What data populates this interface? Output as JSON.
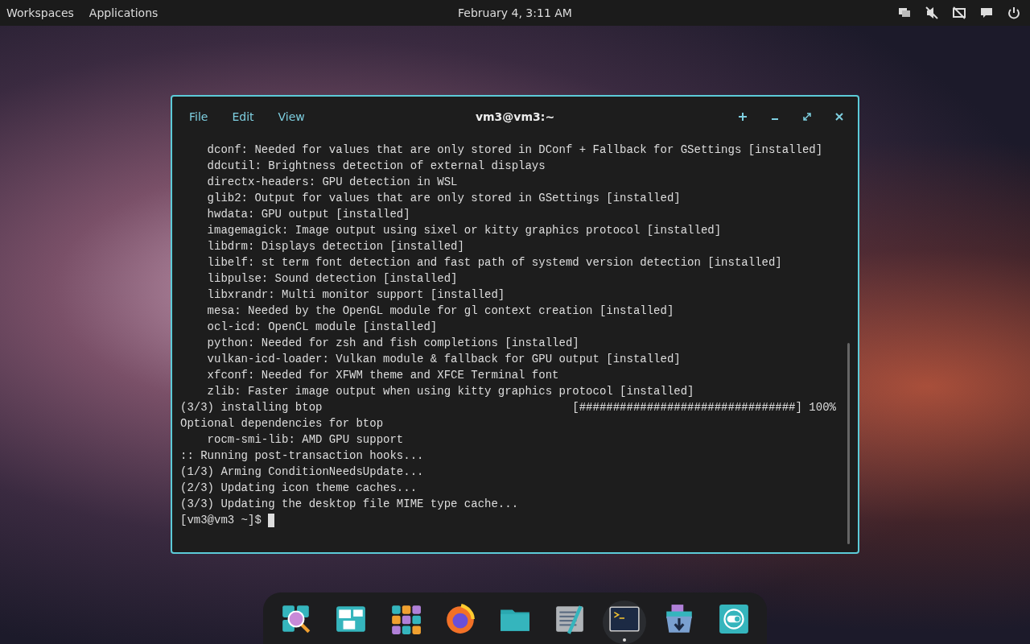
{
  "top_bar": {
    "menus": [
      "Workspaces",
      "Applications"
    ],
    "clock": "February 4, 3:11 AM"
  },
  "terminal": {
    "title": "vm3@vm3:~",
    "menu": [
      "File",
      "Edit",
      "View"
    ],
    "lines": [
      "    dconf: Needed for values that are only stored in DConf + Fallback for GSettings [installed]",
      "    ddcutil: Brightness detection of external displays",
      "    directx-headers: GPU detection in WSL",
      "    glib2: Output for values that are only stored in GSettings [installed]",
      "    hwdata: GPU output [installed]",
      "    imagemagick: Image output using sixel or kitty graphics protocol [installed]",
      "    libdrm: Displays detection [installed]",
      "    libelf: st term font detection and fast path of systemd version detection [installed]",
      "    libpulse: Sound detection [installed]",
      "    libxrandr: Multi monitor support [installed]",
      "    mesa: Needed by the OpenGL module for gl context creation [installed]",
      "    ocl-icd: OpenCL module [installed]",
      "    python: Needed for zsh and fish completions [installed]",
      "    vulkan-icd-loader: Vulkan module & fallback for GPU output [installed]",
      "    xfconf: Needed for XFWM theme and XFCE Terminal font",
      "    zlib: Faster image output when using kitty graphics protocol [installed]",
      "(3/3) installing btop                                     [################################] 100%",
      "Optional dependencies for btop",
      "    rocm-smi-lib: AMD GPU support",
      ":: Running post-transaction hooks...",
      "(1/3) Arming ConditionNeedsUpdate...",
      "(2/3) Updating icon theme caches...",
      "(3/3) Updating the desktop file MIME type cache..."
    ],
    "prompt": "[vm3@vm3 ~]$ "
  },
  "dock": [
    {
      "running": false
    },
    {
      "running": false
    },
    {
      "running": false
    },
    {
      "running": false
    },
    {
      "running": false
    },
    {
      "running": false
    },
    {
      "running": true
    },
    {
      "running": false
    },
    {
      "running": false
    }
  ]
}
